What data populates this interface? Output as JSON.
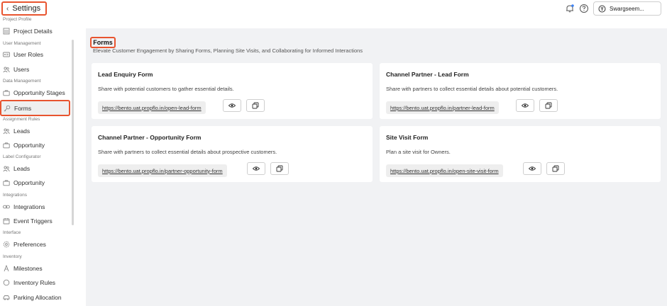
{
  "header": {
    "back_label": "Settings",
    "org_name": "Swargseem...",
    "accent_color": "#e8542f"
  },
  "sidebar": {
    "groups": {
      "project_profile": "Project Profile",
      "user_management": "User Management",
      "data_management": "Data Management",
      "assignment_rules": "Assignment Rules",
      "label_configurator": "Label Configurator",
      "integrations": "Integrations",
      "interface": "Interface",
      "inventory": "Inventory"
    },
    "items": [
      {
        "label": "Project Details",
        "icon": "building-icon"
      },
      {
        "label": "User Roles",
        "icon": "id-card-icon"
      },
      {
        "label": "Users",
        "icon": "users-icon"
      },
      {
        "label": "Opportunity Stages",
        "icon": "briefcase-icon"
      },
      {
        "label": "Forms",
        "icon": "key-icon",
        "active": true
      },
      {
        "label": "Leads",
        "icon": "users-icon"
      },
      {
        "label": "Opportunity",
        "icon": "briefcase-icon"
      },
      {
        "label": "Leads",
        "icon": "users-icon"
      },
      {
        "label": "Opportunity",
        "icon": "briefcase-icon"
      },
      {
        "label": "Integrations",
        "icon": "link-icon"
      },
      {
        "label": "Event Triggers",
        "icon": "calendar-icon"
      },
      {
        "label": "Preferences",
        "icon": "gear-icon"
      },
      {
        "label": "Milestones",
        "icon": "milestone-icon"
      },
      {
        "label": "Inventory Rules",
        "icon": "circle-icon"
      },
      {
        "label": "Parking Allocation",
        "icon": "car-icon"
      }
    ]
  },
  "main": {
    "title": "Forms",
    "subtitle": "Elevate Customer Engagement by Sharing Forms, Planning Site Visits, and Collaborating for Informed Interactions",
    "cards": [
      {
        "title": "Lead Enquiry Form",
        "desc": "Share with potential customers to gather essential details.",
        "link": "https://bento.uat.propflo.in/open-lead-form"
      },
      {
        "title": "Channel Partner - Lead Form",
        "desc": "Share with partners to collect essential details about potential customers.",
        "link": "https://bento.uat.propflo.in/partner-lead-form"
      },
      {
        "title": "Channel Partner - Opportunity Form",
        "desc": "Share with partners to collect essential details about prospective customers.",
        "link": "https://bento.uat.propflo.in/partner-opportunity-form"
      },
      {
        "title": "Site Visit Form",
        "desc": "Plan a site visit for Owners.",
        "link": "https://bento.uat.propflo.in/open-site-visit-form"
      }
    ]
  }
}
